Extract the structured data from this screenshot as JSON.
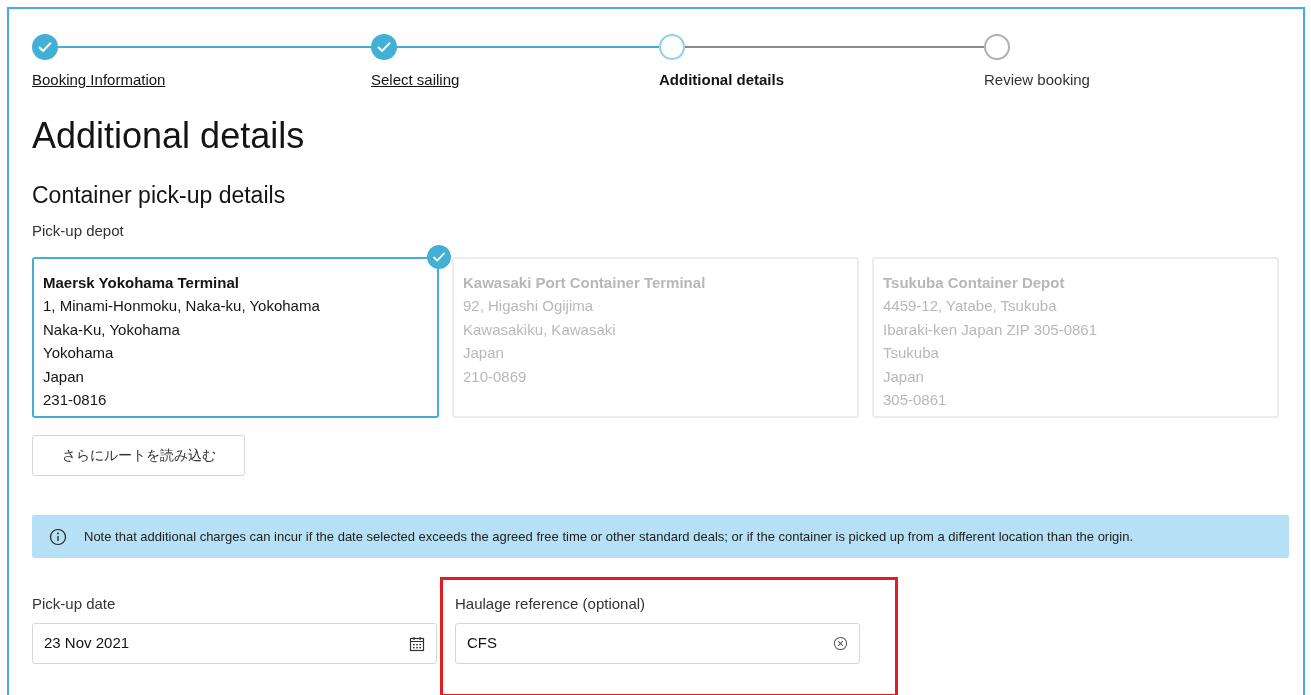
{
  "steps": [
    {
      "label": "Booking Information",
      "kind": "completed"
    },
    {
      "label": "Select sailing",
      "kind": "completed"
    },
    {
      "label": "Additional details",
      "kind": "current"
    },
    {
      "label": "Review booking",
      "kind": "upcoming"
    }
  ],
  "page_title": "Additional details",
  "section_title": "Container pick-up details",
  "depot_label": "Pick-up depot",
  "depots": [
    {
      "name": "Maersk Yokohama Terminal",
      "lines": [
        "1, Minami-Honmoku, Naka-ku, Yokohama",
        "Naka-Ku, Yokohama",
        "Yokohama",
        "Japan",
        "231-0816"
      ],
      "selected": true
    },
    {
      "name": "Kawasaki Port Container Terminal",
      "lines": [
        "92, Higashi Ogijima",
        "Kawasakiku, Kawasaki",
        "Japan",
        "210-0869"
      ],
      "selected": false
    },
    {
      "name": "Tsukuba Container Depot",
      "lines": [
        "4459-12, Yatabe, Tsukuba",
        "Ibaraki-ken Japan ZIP 305-0861",
        "Tsukuba",
        "Japan",
        "305-0861"
      ],
      "selected": false
    }
  ],
  "load_more_button": "さらにルートを読み込む",
  "info_note": "Note that additional charges can incur if the date selected exceeds the agreed free time or other standard deals; or if the container is picked up from a different location than the origin.",
  "fields": [
    {
      "label": "Pick-up date",
      "value": "23 Nov 2021",
      "kind": "date",
      "highlighted": false
    },
    {
      "label": "Haulage reference (optional)",
      "value": "CFS",
      "kind": "clearable",
      "highlighted": true
    }
  ]
}
